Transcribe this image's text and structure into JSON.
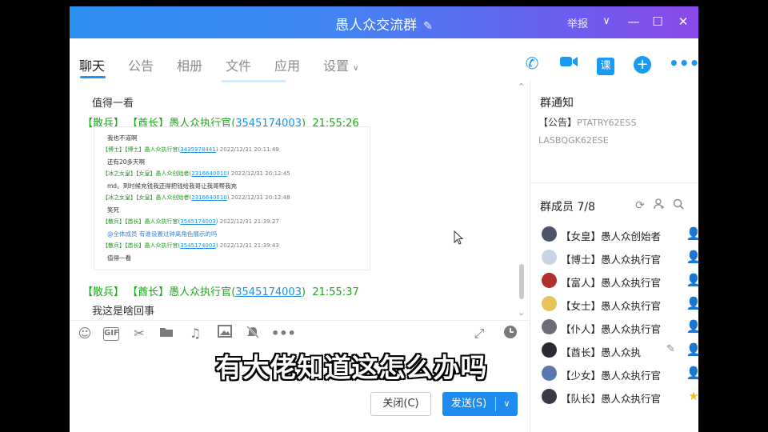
{
  "window": {
    "title": "愚人众交流群",
    "report_label": "举报"
  },
  "tabs": [
    "聊天",
    "公告",
    "相册",
    "文件",
    "应用",
    "设置"
  ],
  "toolbar_icons": [
    "phone-icon",
    "video-icon",
    "course-icon",
    "add-icon",
    "more-icon"
  ],
  "toolbar": {
    "course_label": "课"
  },
  "chat": {
    "messages": [
      {
        "text": "值得一看"
      },
      {
        "rank": "【散兵】",
        "title": "【酋长】",
        "name": "愚人众执行官",
        "qq": "3545174003",
        "time": "21:55:26"
      },
      {
        "rank": "【散兵】",
        "title": "【酋长】",
        "name": "愚人众执行官",
        "qq": "3545174003",
        "time": "21:55:37"
      },
      {
        "text": "我这是啥回事"
      }
    ],
    "forwarded": [
      {
        "kind": "text",
        "text": "我也不道啊"
      },
      {
        "kind": "head",
        "pre": "【博士】【博士】愚人众执行官(",
        "qq": "3435978441",
        "post": ")",
        "time": " 2022/12/31 20:11:49"
      },
      {
        "kind": "text",
        "text": "还有20多天啊"
      },
      {
        "kind": "head",
        "pre": "【冰之女皇】【女皇】愚人众创始者(",
        "qq": "2316640010",
        "post": ")",
        "time": " 2022/12/31 20:12:45"
      },
      {
        "kind": "text",
        "text": "md。到时候充钱我还得把钱给我哥让我哥帮我充"
      },
      {
        "kind": "head",
        "pre": "【冰之女皇】【女皇】愚人众创始者(",
        "qq": "2316640010",
        "post": ")",
        "time": " 2022/12/31 20:12:48"
      },
      {
        "kind": "text",
        "text": "笑死"
      },
      {
        "kind": "head",
        "pre": "【散兵】【酋长】愚人众执行官(",
        "qq": "3545174003",
        "post": ")",
        "time": " 2022/12/31 21:39:27"
      },
      {
        "kind": "blue",
        "text": "@全体成员  有谁设置过钟离角色展示的吗"
      },
      {
        "kind": "head",
        "pre": "【散兵】【酋长】愚人众执行官(",
        "qq": "3545174003",
        "post": ")",
        "time": " 2022/12/31 21:39:43"
      },
      {
        "kind": "text",
        "text": "值得一看"
      }
    ]
  },
  "input_icons": [
    "emoji-icon",
    "gif-icon",
    "scissors-icon",
    "folder-icon",
    "music-icon",
    "image-icon",
    "mute-icon",
    "more-icon"
  ],
  "input": {
    "gif_label": "GIF"
  },
  "buttons": {
    "close": "关闭(C)",
    "send": "发送(S)"
  },
  "subtitle": "有大佬知道这怎么办吗",
  "notice": {
    "title": "群通知",
    "label": "【公告】",
    "line1": "PTATRY62ESS",
    "line2": "LASBQGK62ESE"
  },
  "members": {
    "title": "群成员 7/8",
    "list": [
      {
        "label": "【女皇】愚人众创始者",
        "role_icon": "owner-icon",
        "avatar": "#4a5568"
      },
      {
        "label": "【博士】愚人众执行官",
        "role_icon": "admin-icon",
        "avatar": "#c9d3e6"
      },
      {
        "label": "【富人】愚人众执行官",
        "role_icon": "member-icon",
        "avatar": "#b03030"
      },
      {
        "label": "【女士】愚人众执行官",
        "role_icon": "admin-icon",
        "avatar": "#e6c35a"
      },
      {
        "label": "【仆人】愚人众执行官",
        "role_icon": "member-icon",
        "avatar": "#6b6b7a"
      },
      {
        "label": "【酋长】愚人众执",
        "role_icon": "member-icon",
        "avatar": "#2a2a33"
      },
      {
        "label": "【少女】愚人众执行官",
        "role_icon": "member-icon",
        "avatar": "#5a78b0"
      },
      {
        "label": "【队长】愚人众执行官",
        "role_icon": "owner-star-icon",
        "avatar": "#3a3a44"
      }
    ]
  },
  "colors": {
    "accent": "#1e8bf0",
    "sender_green": "#1ba61b",
    "link_blue": "#1f8fe0"
  }
}
